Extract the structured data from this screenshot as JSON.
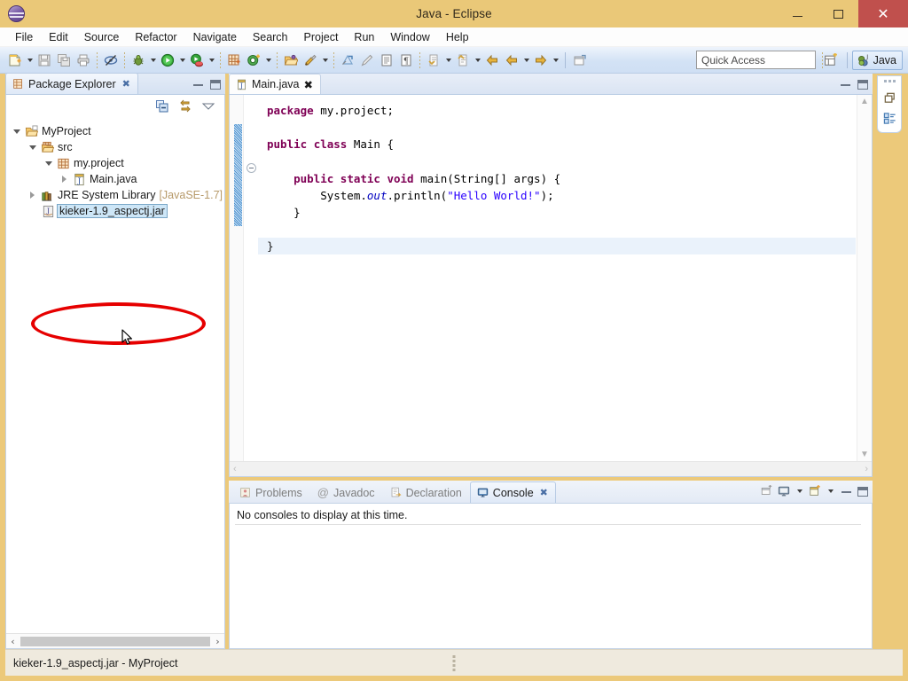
{
  "window": {
    "title": "Java - Eclipse",
    "app_icon": "eclipse-icon",
    "minimize_label": "Minimize",
    "maximize_label": "Maximize",
    "close_label": "Close",
    "frame_color": "#ecc97a",
    "titlebar_color": "#eac878",
    "close_button_color": "#c0504d"
  },
  "menubar": {
    "items": [
      {
        "label": "File"
      },
      {
        "label": "Edit"
      },
      {
        "label": "Source"
      },
      {
        "label": "Refactor"
      },
      {
        "label": "Navigate"
      },
      {
        "label": "Search"
      },
      {
        "label": "Project"
      },
      {
        "label": "Run"
      },
      {
        "label": "Window"
      },
      {
        "label": "Help"
      }
    ]
  },
  "toolbar": {
    "buttons": [
      {
        "name": "new-wizard",
        "icon": "new-file-icon",
        "has_dropdown": true
      },
      {
        "name": "save",
        "icon": "save-icon",
        "has_dropdown": false
      },
      {
        "name": "save-all",
        "icon": "save-all-icon",
        "has_dropdown": false
      },
      {
        "name": "print",
        "icon": "print-icon",
        "has_dropdown": false
      },
      {
        "name": "toggle-mark-occurrences",
        "icon": "mark-occurrences-icon",
        "has_dropdown": false
      },
      {
        "name": "debug",
        "icon": "debug-bug-icon",
        "has_dropdown": true
      },
      {
        "name": "run",
        "icon": "run-green-play-icon",
        "has_dropdown": true
      },
      {
        "name": "coverage",
        "icon": "coverage-icon",
        "has_dropdown": true
      },
      {
        "name": "new-java-package",
        "icon": "new-package-icon",
        "has_dropdown": false
      },
      {
        "name": "new-java-class",
        "icon": "new-class-icon",
        "has_dropdown": true
      },
      {
        "name": "open-type",
        "icon": "open-folder-icon",
        "has_dropdown": false
      },
      {
        "name": "external-tools",
        "icon": "external-tools-icon",
        "has_dropdown": true
      },
      {
        "name": "search",
        "icon": "search-icon",
        "has_dropdown": false
      },
      {
        "name": "last-edit-location",
        "icon": "pencil-icon",
        "has_dropdown": false
      },
      {
        "name": "show-whitespace",
        "icon": "whitespace-icon",
        "has_dropdown": false
      },
      {
        "name": "pilcrow",
        "icon": "pilcrow-icon",
        "has_dropdown": false
      },
      {
        "name": "next-annotation",
        "icon": "next-annotation-icon",
        "has_dropdown": true
      },
      {
        "name": "previous-annotation",
        "icon": "previous-annotation-icon",
        "has_dropdown": true
      },
      {
        "name": "back",
        "icon": "arrow-left-icon",
        "has_dropdown": false
      },
      {
        "name": "back-history",
        "icon": "arrow-left-icon",
        "has_dropdown": true
      },
      {
        "name": "forward",
        "icon": "arrow-right-icon",
        "has_dropdown": true
      },
      {
        "name": "pin-editor",
        "icon": "pin-editor-icon",
        "has_dropdown": false
      }
    ],
    "quick_access": {
      "placeholder": "Quick Access",
      "value": ""
    },
    "open_perspective_label": "Open Perspective",
    "perspective": {
      "label": "Java",
      "icon": "java-perspective-icon",
      "active": true
    }
  },
  "package_explorer": {
    "tab_label": "Package Explorer",
    "tab_icon": "package-explorer-icon",
    "close_label": "Close",
    "local_tools": [
      {
        "name": "collapse-all-icon",
        "label": "Collapse All"
      },
      {
        "name": "link-with-editor-icon",
        "label": "Link with Editor"
      },
      {
        "name": "view-menu-icon",
        "label": "View Menu"
      }
    ],
    "minimize_label": "Minimize",
    "maximize_label": "Maximize",
    "tree": [
      {
        "label": "MyProject",
        "icon": "java-project-icon",
        "indent": 0,
        "twisty": "open",
        "selected": false,
        "dim_suffix": ""
      },
      {
        "label": "src",
        "icon": "source-folder-icon",
        "indent": 1,
        "twisty": "open",
        "selected": false,
        "dim_suffix": ""
      },
      {
        "label": "my.project",
        "icon": "package-icon",
        "indent": 2,
        "twisty": "open",
        "selected": false,
        "dim_suffix": ""
      },
      {
        "label": "Main.java",
        "icon": "java-file-icon",
        "indent": 3,
        "twisty": "closed",
        "selected": false,
        "dim_suffix": ""
      },
      {
        "label": "JRE System Library",
        "icon": "library-icon",
        "indent": 1,
        "twisty": "closed",
        "selected": false,
        "dim_suffix": "[JavaSE-1.7]"
      },
      {
        "label": "kieker-1.9_aspectj.jar",
        "icon": "jar-icon",
        "indent": 1,
        "twisty": "none",
        "selected": true,
        "dim_suffix": ""
      }
    ],
    "scrollbar": {
      "left_arrow": "‹",
      "right_arrow": "›"
    }
  },
  "editor": {
    "tab_label": "Main.java",
    "tab_icon": "java-file-icon",
    "close_label": "Close",
    "minimize_label": "Minimize",
    "maximize_label": "Maximize",
    "code_lines": [
      {
        "text": "package my.project;",
        "type": "code"
      },
      {
        "text": "",
        "type": "blank"
      },
      {
        "text": "public class Main {",
        "type": "code"
      },
      {
        "text": "",
        "type": "blank"
      },
      {
        "text": "    public static void main(String[] args) {",
        "type": "code"
      },
      {
        "text": "        System.out.println(\"Hello World!\");",
        "type": "code"
      },
      {
        "text": "    }",
        "type": "code"
      },
      {
        "text": "",
        "type": "blank"
      },
      {
        "text": "}",
        "type": "code",
        "current": true
      }
    ],
    "syntax_colors": {
      "keyword": "#7f0055",
      "string": "#2a00ff",
      "field": "#0000c0",
      "plain": "#000000",
      "current_line": "#eaf2fb"
    },
    "fold_marker": "collapse-fold-icon",
    "scrollbar": {
      "up_arrow": "▲",
      "down_arrow": "▼",
      "left_arrow": "‹",
      "right_arrow": "›"
    }
  },
  "console_panel": {
    "tabs": [
      {
        "label": "Problems",
        "icon": "problems-icon",
        "active": false
      },
      {
        "label": "Javadoc",
        "icon": "javadoc-at-icon",
        "active": false
      },
      {
        "label": "Declaration",
        "icon": "declaration-icon",
        "active": false
      },
      {
        "label": "Console",
        "icon": "console-icon",
        "active": true
      }
    ],
    "close_label": "Close",
    "message": "No consoles to display at this time.",
    "tools": [
      {
        "name": "open-console-icon",
        "label": "Open Console"
      },
      {
        "name": "display-selected-console-icon",
        "label": "Display Selected Console",
        "has_dropdown": true
      },
      {
        "name": "new-console-view-icon",
        "label": "New Console View",
        "has_dropdown": true
      }
    ],
    "minimize_label": "Minimize",
    "maximize_label": "Maximize"
  },
  "fastview": {
    "items": [
      {
        "name": "restore-icon",
        "label": "Restore"
      },
      {
        "name": "outline-view-icon",
        "label": "Outline"
      }
    ]
  },
  "statusbar": {
    "text": "kieker-1.9_aspectj.jar - MyProject"
  },
  "annotation": {
    "type": "red-ellipse-highlight",
    "color": "#e60000",
    "targets": "kieker-1.9_aspectj.jar"
  },
  "cursor": {
    "type": "arrow-pointer"
  }
}
